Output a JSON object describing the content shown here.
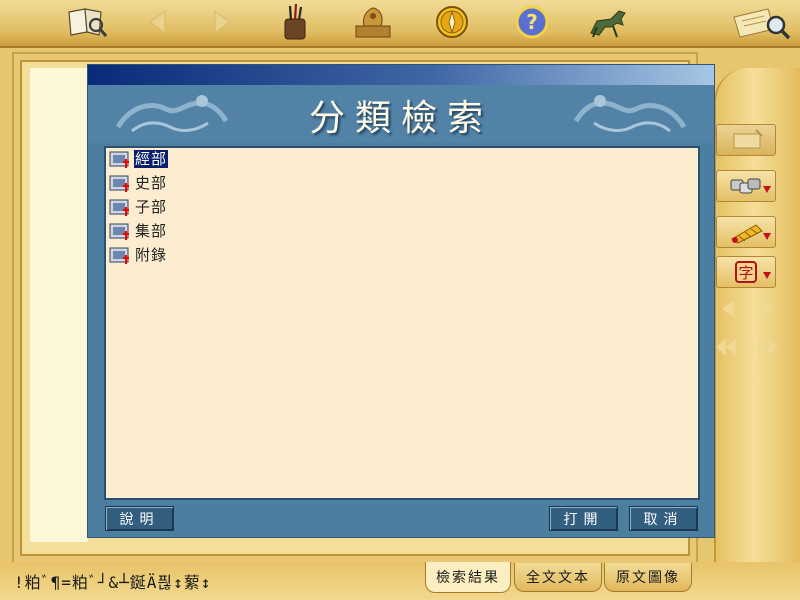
{
  "toolbar": {
    "icons": [
      "book-search-icon",
      "back-arrow-icon",
      "forward-arrow-icon",
      "brush-holder-icon",
      "seal-icon",
      "compass-icon",
      "help-icon",
      "bronze-horse-icon",
      "magnifier-scroll-icon"
    ]
  },
  "dialog": {
    "title": "分類檢索",
    "tree": [
      {
        "label": "經部",
        "selected": true
      },
      {
        "label": "史部",
        "selected": false
      },
      {
        "label": "子部",
        "selected": false
      },
      {
        "label": "集部",
        "selected": false
      },
      {
        "label": "附錄",
        "selected": false
      }
    ],
    "buttons": {
      "help": "說明",
      "open": "打開",
      "cancel": "取消"
    }
  },
  "sidebar": {
    "items": [
      "blank-card-icon",
      "link-chain-icon",
      "bamboo-slips-icon",
      "character-icon"
    ]
  },
  "status": {
    "text": "!粕ﾞ¶=粕ﾞ┘&┴鋋Ä픦↕蕠↕"
  },
  "tabs": {
    "search_results": "檢索結果",
    "full_text": "全文文本",
    "original_image": "原文圖像"
  },
  "colors": {
    "dialog_bg": "#4b7ea1",
    "tree_bg": "#fdedd0",
    "selection": "#0b1f6b",
    "parchment": "#e7c670"
  }
}
